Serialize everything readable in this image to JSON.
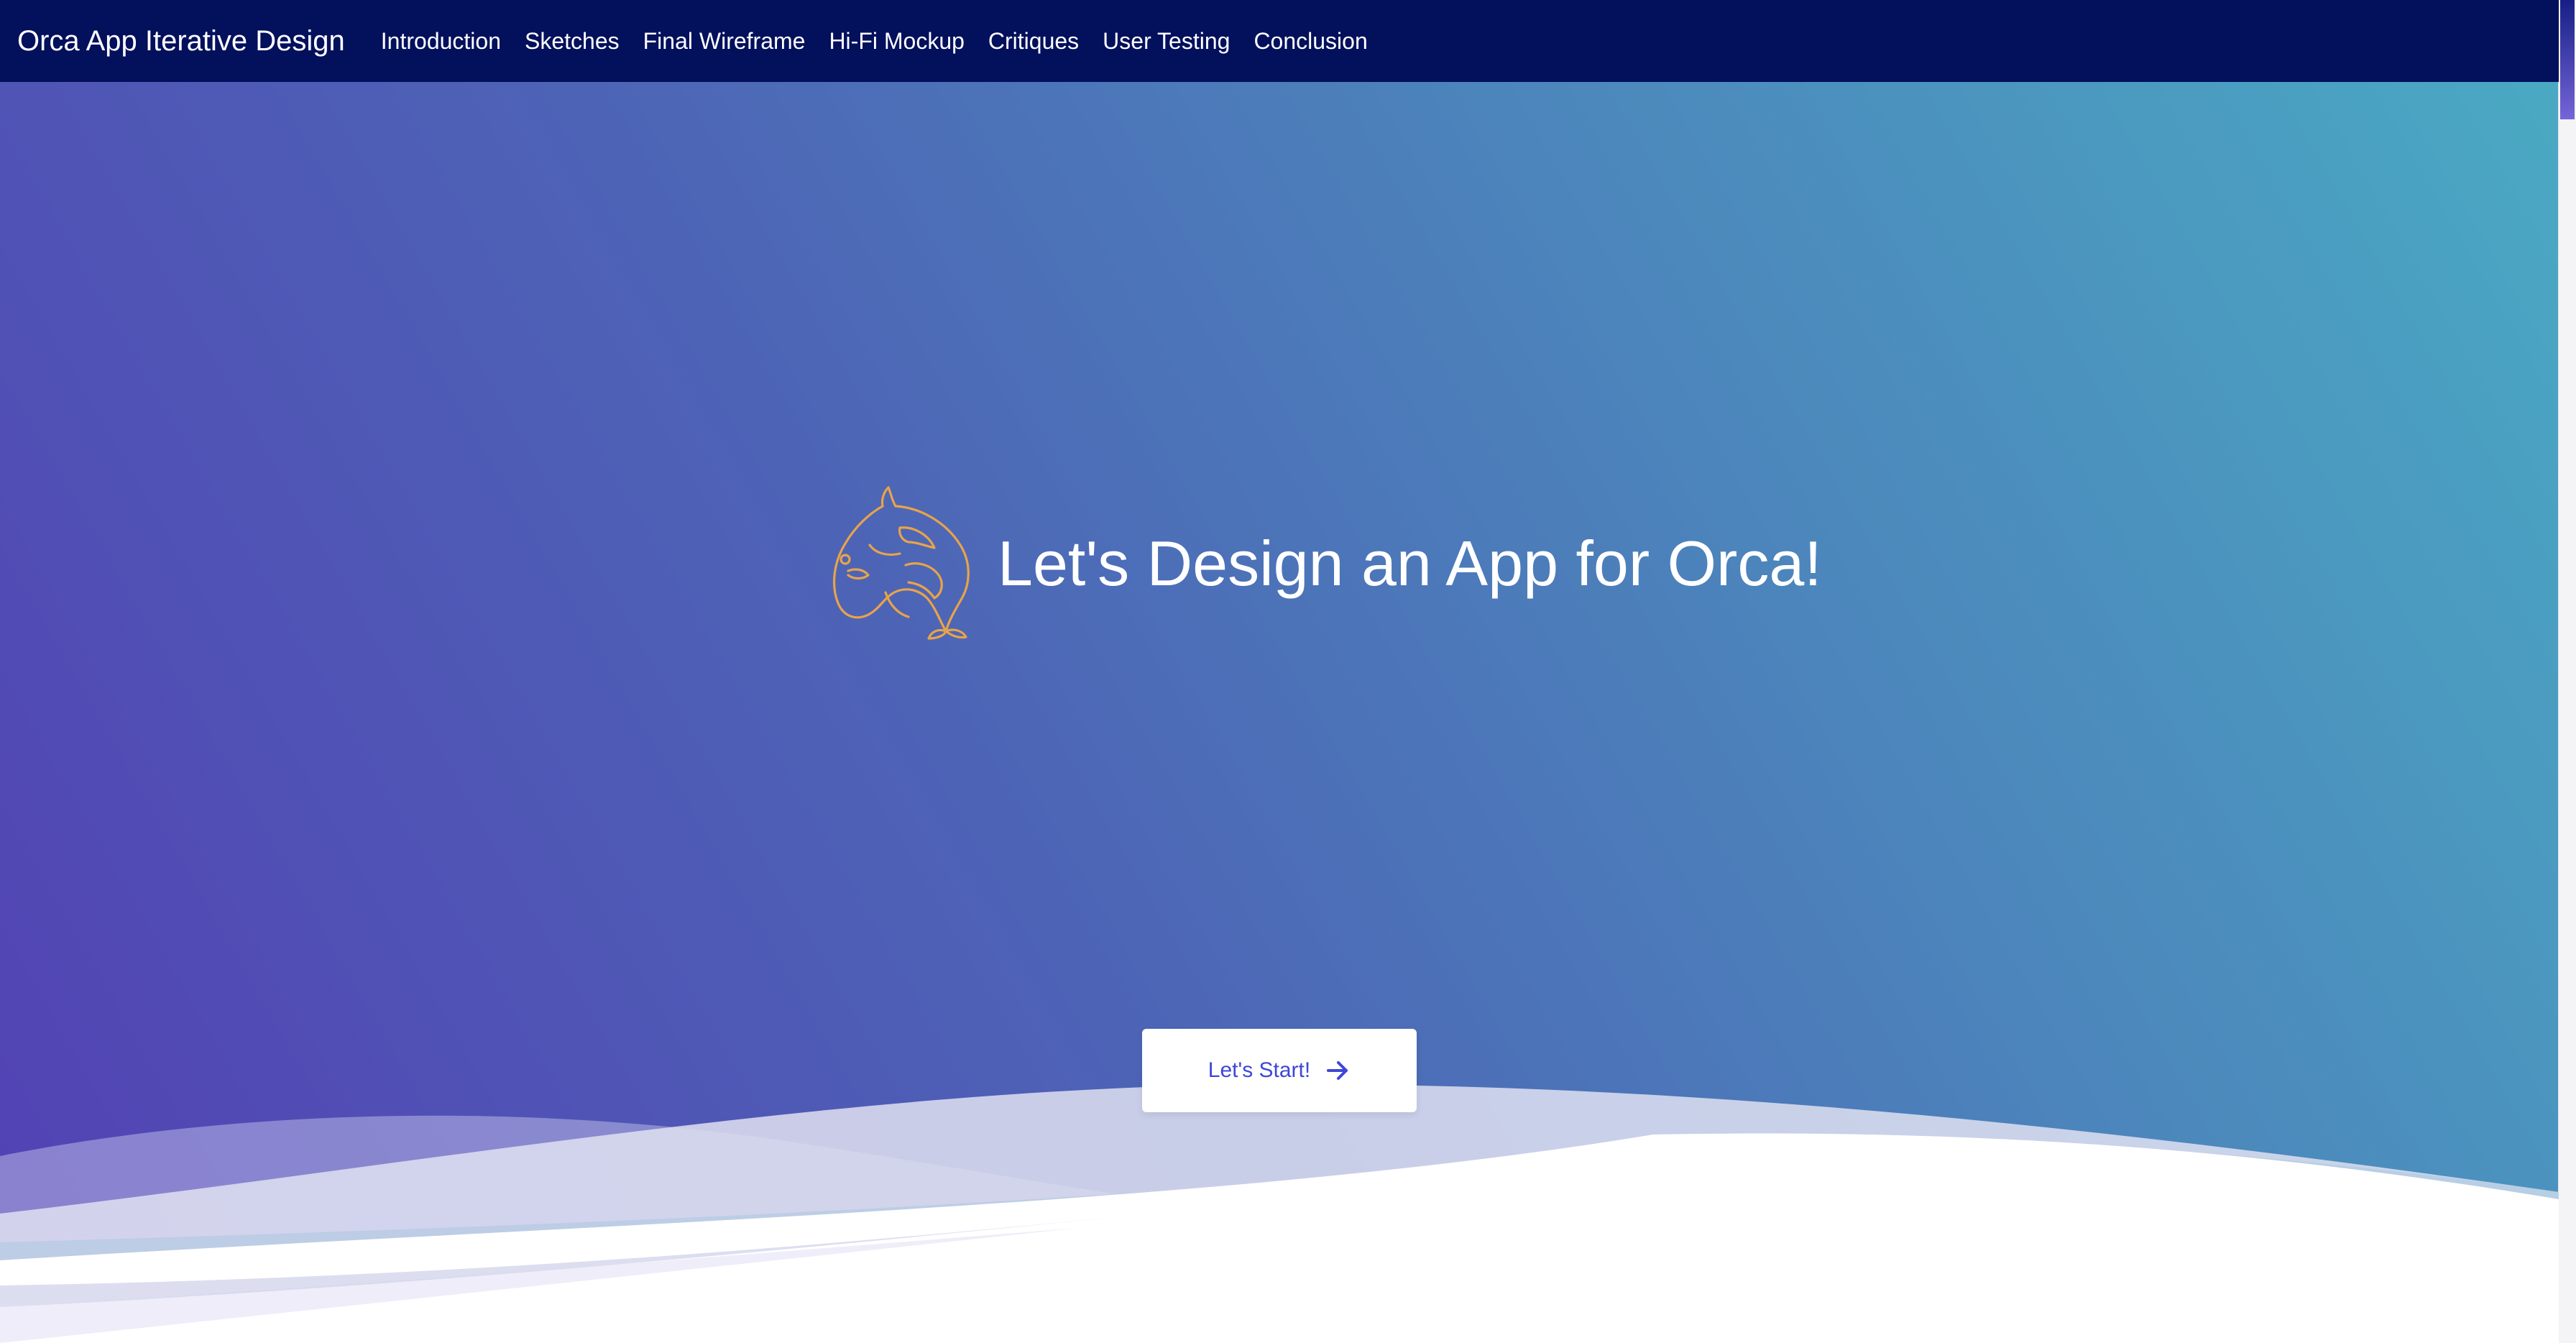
{
  "navbar": {
    "brand": "Orca App Iterative Design",
    "links": [
      {
        "label": "Introduction"
      },
      {
        "label": "Sketches"
      },
      {
        "label": "Final Wireframe"
      },
      {
        "label": "Hi-Fi Mockup"
      },
      {
        "label": "Critiques"
      },
      {
        "label": "User Testing"
      },
      {
        "label": "Conclusion"
      }
    ]
  },
  "hero": {
    "logo_icon": "orca-icon",
    "title": "Let's Design an App for Orca!",
    "cta_label": "Let's Start!",
    "cta_icon": "arrow-right-icon"
  },
  "colors": {
    "navbar_bg": "#03105c",
    "gradient_start": "#5340b4",
    "gradient_end": "#4aa9c3",
    "logo_stroke": "#e8a34a",
    "cta_text": "#3f47d6"
  }
}
